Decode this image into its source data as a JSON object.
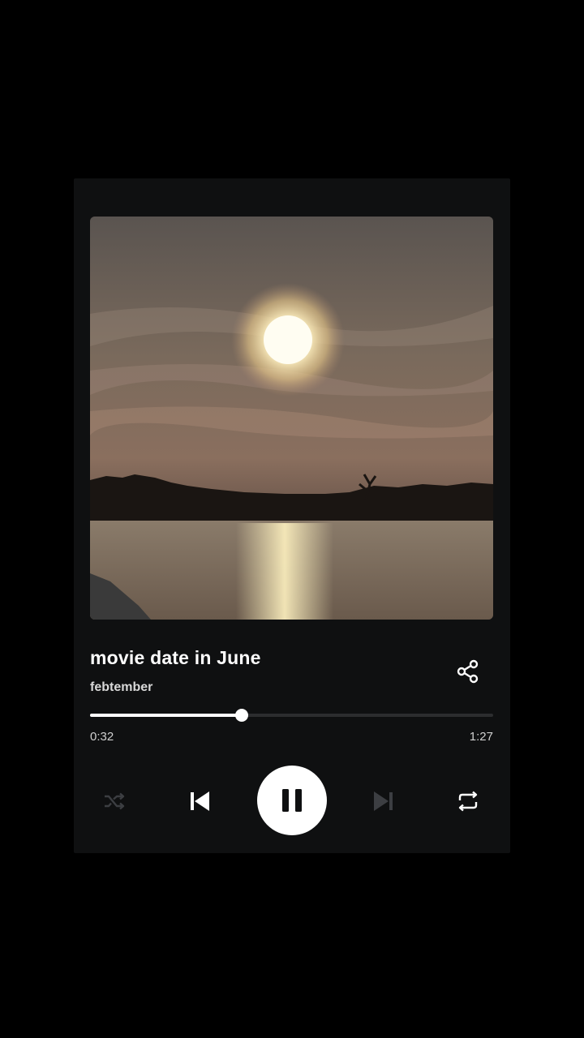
{
  "player": {
    "track_title": "movie date in June",
    "artist": "febtember",
    "progress_fraction": 0.3765,
    "time_current": "0:32",
    "time_total": "1:27",
    "is_playing": true,
    "shuffle_enabled": false,
    "repeat_enabled": true
  },
  "icons": {
    "share": "share-icon",
    "shuffle": "shuffle-icon",
    "previous": "skip-previous-icon",
    "play_pause": "pause-icon",
    "next": "skip-next-icon",
    "repeat": "repeat-icon"
  },
  "colors": {
    "background": "#000000",
    "card": "#0f1011",
    "primary_text": "#ffffff",
    "track": "#2c2d2f",
    "disabled_icon": "#3c3e42"
  }
}
